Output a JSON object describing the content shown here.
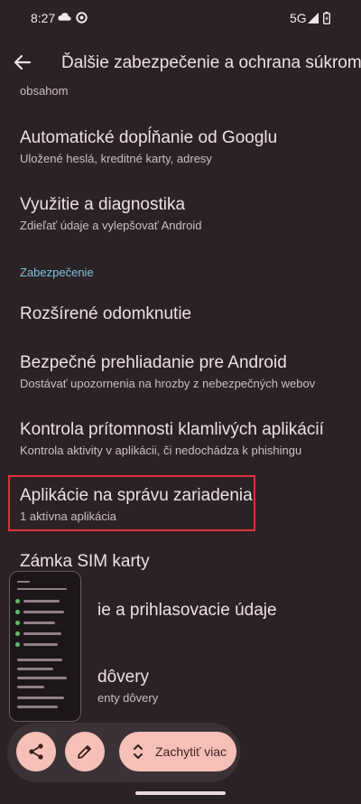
{
  "status_bar": {
    "time": "8:27",
    "network": "5G"
  },
  "header": {
    "title": "Ďalšie zabezpečenie a ochrana súkromia"
  },
  "list": {
    "partial_top": "obsahom",
    "items": [
      {
        "title": "Automatické dopĺňanie od Googlu",
        "subtitle": "Uložené heslá, kreditné karty, adresy"
      },
      {
        "title": "Využitie a diagnostika",
        "subtitle": "Zdieľať údaje a vylepšovať Android"
      },
      {
        "title": "Rozšírené odomknutie",
        "subtitle": ""
      },
      {
        "title": "Bezpečné prehliadanie pre Android",
        "subtitle": "Dostávať upozornenia na hrozby z nebezpečných webov"
      },
      {
        "title": "Kontrola prítomnosti klamlivých aplikácií",
        "subtitle": "Kontrola aktivity v aplikácii, či nedochádza k phishingu"
      },
      {
        "title": "Aplikácie na správu zariadenia",
        "subtitle": "1 aktívna aplikácia"
      },
      {
        "title": "Zámka SIM karty",
        "subtitle": ""
      },
      {
        "title": "ie a prihlasovacie údaje",
        "subtitle": ""
      },
      {
        "title": "dôvery",
        "subtitle": "enty dôvery"
      }
    ],
    "section_label": "Zabezpečenie"
  },
  "screenshot_toolbar": {
    "share_icon": "share-icon",
    "edit_icon": "pencil-icon",
    "capture_more_label": "Zachytiť viac"
  },
  "colors": {
    "background": "#2b2226",
    "section_accent": "#7ec3d8",
    "highlight": "#e0303a",
    "button": "#f5c0b8"
  }
}
